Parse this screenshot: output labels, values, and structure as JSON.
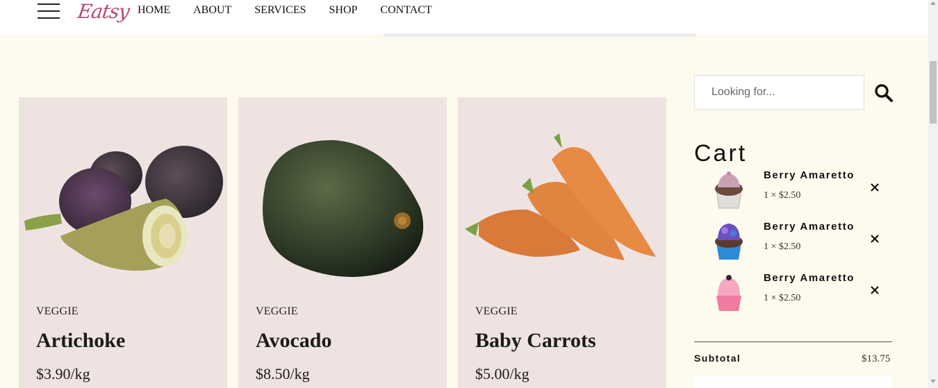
{
  "header": {
    "logo": "Eatsy",
    "nav": [
      "HOME",
      "ABOUT",
      "SERVICES",
      "SHOP",
      "CONTACT"
    ]
  },
  "products": [
    {
      "category": "VEGGIE",
      "name": "Artichoke",
      "price": "$3.90/kg",
      "image": "artichoke"
    },
    {
      "category": "VEGGIE",
      "name": "Avocado",
      "price": "$8.50/kg",
      "image": "avocado"
    },
    {
      "category": "VEGGIE",
      "name": "Baby Carrots",
      "price": "$5.00/kg",
      "image": "carrots"
    }
  ],
  "search": {
    "placeholder": "Looking for...",
    "icon": "search-icon"
  },
  "cart": {
    "title": "Cart",
    "items": [
      {
        "name": "Berry Amaretto",
        "price": "1 × $2.50",
        "color": "#c9a0b4"
      },
      {
        "name": "Berry Amaretto",
        "price": "1 × $2.50",
        "color": "#6a4fc0"
      },
      {
        "name": "Berry Amaretto",
        "price": "1 × $2.50",
        "color": "#f07aa0"
      }
    ],
    "subtotal_label": "Subtotal",
    "subtotal_value": "$13.75"
  },
  "colors": {
    "page_bg": "#fdfaee",
    "card_bg": "#efe3e2",
    "logo": "#b44a6a"
  }
}
